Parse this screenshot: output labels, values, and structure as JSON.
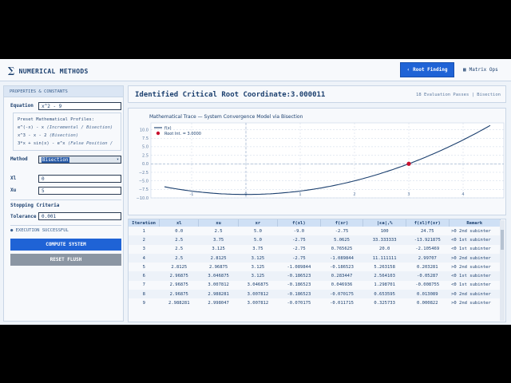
{
  "app": {
    "title": "NUMERICAL METHODS"
  },
  "nav": {
    "root_finding": "Root Finding",
    "matrix_ops": "Matrix Ops"
  },
  "sidebar": {
    "header": "PROPERTIES & CONSTANTS",
    "equation_label": "Equation",
    "equation_value": "x^2 - 9",
    "preset_title": "Preset Mathematical Profiles:",
    "presets": [
      {
        "expr": "e^(-x) - x",
        "note": "(Incremental / Bisection)"
      },
      {
        "expr": "x^3 - x - 2",
        "note": "(Bisection)"
      },
      {
        "expr": "3*x + sin(x) - e^x",
        "note": "(False Position /"
      }
    ],
    "method_label": "Method",
    "method_value": "Bisection",
    "xl_label": "Xl",
    "xl_value": "0",
    "xu_label": "Xu",
    "xu_value": "5",
    "stopping_label": "Stopping Criteria",
    "tolerance_label": "Tolerance",
    "tolerance_value": "0.001",
    "status": "EXECUTION SUCCESSFUL",
    "compute_label": "COMPUTE SYSTEM",
    "reset_label": "RESET FLUSH"
  },
  "result": {
    "title": "Identified Critical Root Coordinate:",
    "value": "3.000011",
    "meta": "18 Evaluation Passes | Bisection"
  },
  "chart_data": {
    "type": "line",
    "title": "Mathematical Trace — System Convergence Model via Bisection",
    "series": [
      {
        "name": "f(x)",
        "function": "x^2 - 9",
        "x_start": -1.5,
        "x_end": 4.5
      }
    ],
    "markers": [
      {
        "name": "Root Int. = 3.0000",
        "x": 3.0,
        "y": 0.0,
        "color": "#c8102e"
      }
    ],
    "xlim": [
      -1.75,
      4.75
    ],
    "ylim": [
      -10,
      12
    ],
    "x_ticks": [
      -1,
      0,
      1,
      2,
      3,
      4
    ],
    "y_ticks": [
      -10.0,
      -7.5,
      -5.0,
      -2.5,
      0.0,
      2.5,
      5.0,
      7.5,
      10.0
    ],
    "y_tick_labels": [
      "−10.0",
      "−7.5",
      "−5.0",
      "−2.5",
      "0.0",
      "2.5",
      "5.0",
      "7.5",
      "10.0"
    ],
    "line_color": "#1b3f6e",
    "grid": true,
    "legend": "top-left"
  },
  "table": {
    "headers": [
      "Iteration",
      "xl",
      "xu",
      "xr",
      "f(xl)",
      "f(xr)",
      "|εa|,%",
      "f(xl)f(xr)",
      "Remark"
    ],
    "rows": [
      [
        "1",
        "0.0",
        "2.5",
        "5.0",
        "-9.0",
        "-2.75",
        "100",
        "24.75",
        ">0 2nd subinter"
      ],
      [
        "2",
        "2.5",
        "3.75",
        "5.0",
        "-2.75",
        "5.0625",
        "33.333333",
        "-13.921875",
        "<0 1st subinter"
      ],
      [
        "3",
        "2.5",
        "3.125",
        "3.75",
        "-2.75",
        "0.765625",
        "20.0",
        "-2.105469",
        "<0 1st subinter"
      ],
      [
        "4",
        "2.5",
        "2.8125",
        "3.125",
        "-2.75",
        "-1.089844",
        "11.111111",
        "2.99707",
        ">0 2nd subinter"
      ],
      [
        "5",
        "2.8125",
        "2.96875",
        "3.125",
        "-1.089844",
        "-0.186523",
        "5.263158",
        "0.203281",
        ">0 2nd subinter"
      ],
      [
        "6",
        "2.96875",
        "3.046875",
        "3.125",
        "-0.186523",
        "0.283447",
        "2.564103",
        "-0.05287",
        "<0 1st subinter"
      ],
      [
        "7",
        "2.96875",
        "3.007812",
        "3.046875",
        "-0.186523",
        "0.046936",
        "1.298701",
        "-0.008755",
        "<0 1st subinter"
      ],
      [
        "8",
        "2.96875",
        "2.988281",
        "3.007812",
        "-0.186523",
        "-0.070175",
        "0.653595",
        "0.013089",
        ">0 2nd subinter"
      ],
      [
        "9",
        "2.988281",
        "2.998047",
        "3.007812",
        "-0.070175",
        "-0.011715",
        "0.325733",
        "0.000822",
        ">0 2nd subinter"
      ]
    ]
  }
}
